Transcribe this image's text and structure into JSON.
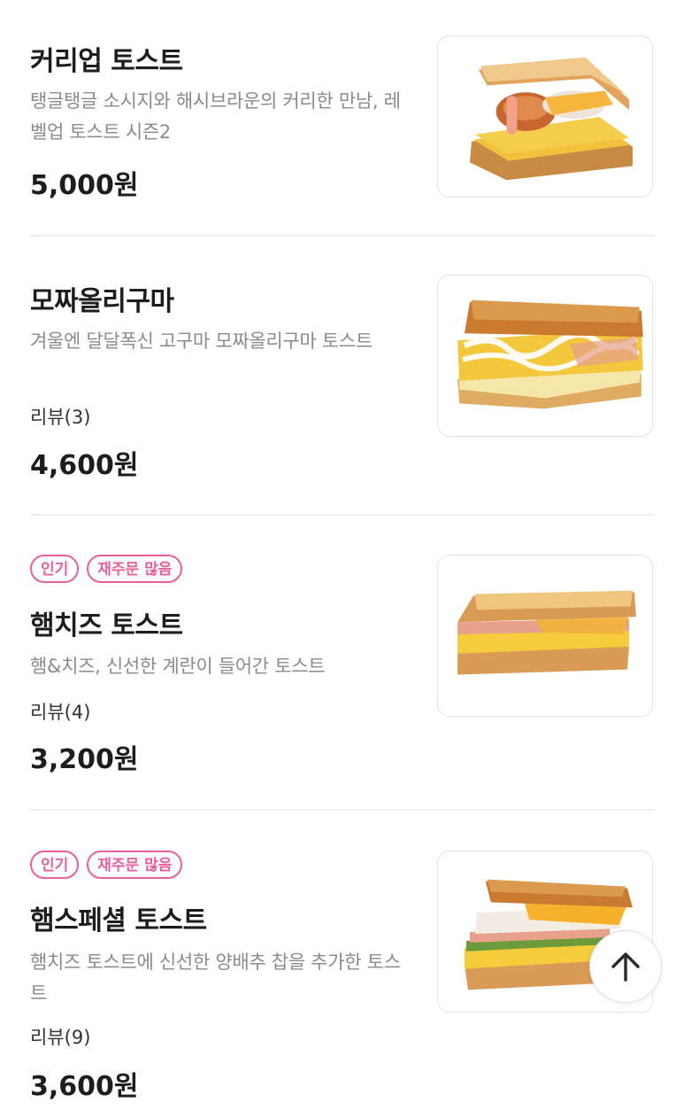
{
  "menu": [
    {
      "title": "커리업 토스트",
      "description": "탱글탱글 소시지와 해시브라운의 커리한 만남, 레벨업 토스트 시즌2",
      "price": "5,000원"
    },
    {
      "title": "모짜올리구마",
      "description": "겨울엔 달달폭신 고구마 모짜올리구마 토스트",
      "review": "리뷰(3)",
      "price": "4,600원"
    },
    {
      "badges": [
        "인기",
        "재주문 많음"
      ],
      "title": "햄치즈 토스트",
      "description": "햄&치즈, 신선한 계란이 들어간 토스트",
      "review": "리뷰(4)",
      "price": "3,200원"
    },
    {
      "badges": [
        "인기",
        "재주문 많음"
      ],
      "title": "햄스페셜 토스트",
      "description": "햄치즈 토스트에 신선한 양배추 찹을 추가한 토스트",
      "review": "리뷰(9)",
      "price": "3,600원"
    }
  ],
  "colors": {
    "badge_accent": "#e95f9c",
    "divider": "#eeeeee",
    "description_text": "#8b8b8b"
  },
  "icons": {
    "scroll_top": "arrow-up-icon"
  }
}
